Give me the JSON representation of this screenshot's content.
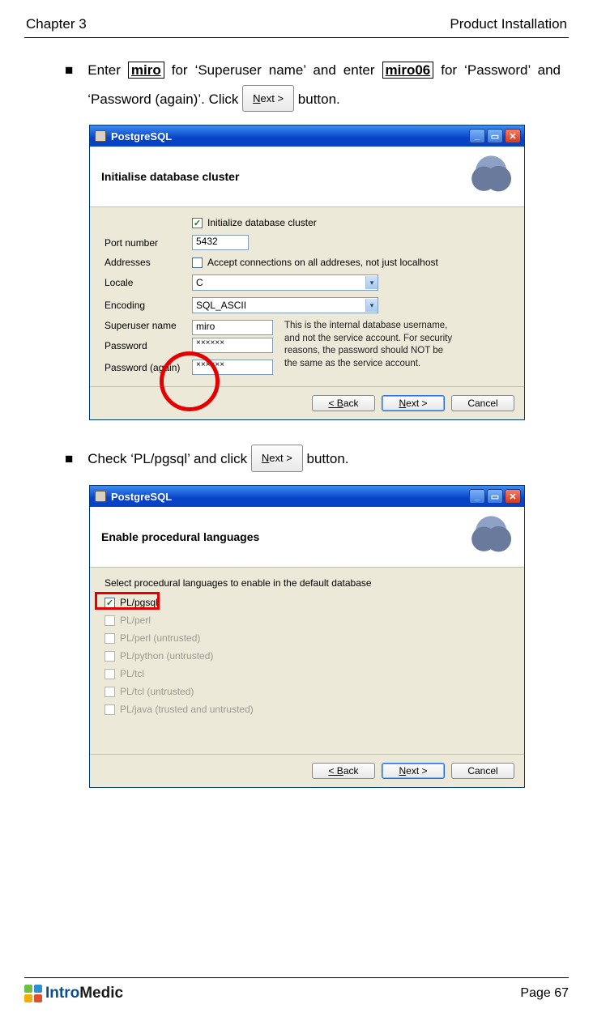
{
  "header": {
    "left": "Chapter 3",
    "right": "Product Installation"
  },
  "step1": {
    "pre": "Enter ",
    "boxed1": "miro",
    "mid1": " for ‘Superuser name’ and enter ",
    "boxed2": "miro06",
    "mid2": " for ‘Password’ and ‘Password (again)’. Click ",
    "btn_pre": "N",
    "btn_post": "ext >",
    "after": " button."
  },
  "step2": {
    "pre": "Check ‘PL/pgsql’ and click ",
    "btn_pre": "N",
    "btn_post": "ext >",
    "after": " button."
  },
  "dlg1": {
    "title": "PostgreSQL",
    "heading": "Initialise database cluster",
    "init_label": "Initialize database cluster",
    "port_label": "Port number",
    "port_value": "5432",
    "addr_label": "Addresses",
    "addr_chk": "Accept connections on all addreses, not just localhost",
    "locale_label": "Locale",
    "locale_value": "C",
    "encoding_label": "Encoding",
    "encoding_value": "SQL_ASCII",
    "super_label": "Superuser name",
    "super_value": "miro",
    "pass_label": "Password",
    "pass_value": "××××××",
    "pass2_label": "Password (again)",
    "pass2_value": "××××××",
    "side_note": "This is the internal database username, and not the service account. For security reasons, the password should NOT be the same as the service account.",
    "back": "< Back",
    "next": "Next >",
    "cancel": "Cancel"
  },
  "dlg2": {
    "title": "PostgreSQL",
    "heading": "Enable procedural languages",
    "instr": "Select procedural languages to enable in the default database",
    "items": [
      {
        "label": "PL/pgsql",
        "checked": true,
        "enabled": true
      },
      {
        "label": "PL/perl",
        "checked": false,
        "enabled": false
      },
      {
        "label": "PL/perl (untrusted)",
        "checked": false,
        "enabled": false
      },
      {
        "label": "PL/python (untrusted)",
        "checked": false,
        "enabled": false
      },
      {
        "label": "PL/tcl",
        "checked": false,
        "enabled": false
      },
      {
        "label": "PL/tcl (untrusted)",
        "checked": false,
        "enabled": false
      },
      {
        "label": "PL/java (trusted and untrusted)",
        "checked": false,
        "enabled": false
      }
    ],
    "back": "< Back",
    "next": "Next >",
    "cancel": "Cancel"
  },
  "footer": {
    "brand_intro": "Intro",
    "brand_medic": "Medic",
    "page": "Page 67"
  }
}
